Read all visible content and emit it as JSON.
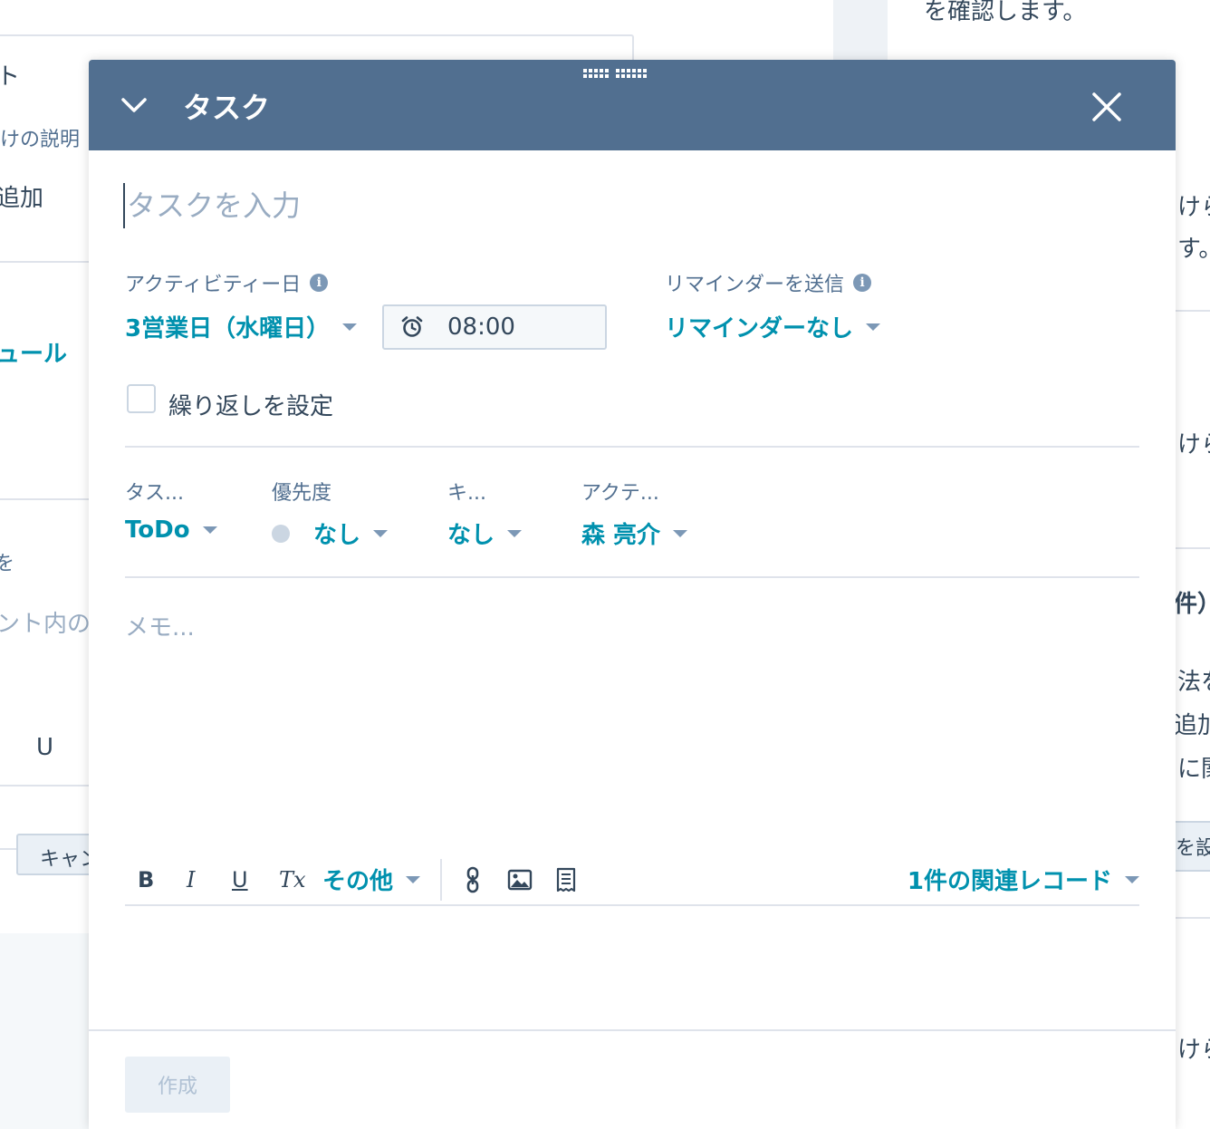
{
  "background": {
    "left_fragments": {
      "text_1": "ト",
      "text_2": "けの説明",
      "text_3": "追加",
      "link_1": "ュール",
      "text_4": "を",
      "text_5": "ント内の",
      "underline_glyph": "U",
      "cancel_button": "キャン"
    },
    "right_fragments": {
      "top_text": "を確認します。",
      "text_1": "けら",
      "text_2": "す。",
      "text_3": "けら",
      "text_4": "件）",
      "text_5": "法を",
      "text_6": "追加",
      "text_7": "に関",
      "button": "を設",
      "text_8": "けら"
    }
  },
  "modal": {
    "title": "タスク",
    "task_input": {
      "placeholder": "タスクを入力",
      "value": ""
    },
    "activity_date": {
      "label": "アクティビティー日",
      "value": "3営業日（水曜日）",
      "time": "08:00"
    },
    "reminder": {
      "label": "リマインダーを送信",
      "value": "リマインダーなし"
    },
    "repeat": {
      "label": "繰り返しを設定",
      "checked": false
    },
    "properties": [
      {
        "label": "タス...",
        "value": "ToDo"
      },
      {
        "label": "優先度",
        "value": "なし"
      },
      {
        "label": "キ...",
        "value": "なし"
      },
      {
        "label": "アクテ...",
        "value": "森 亮介"
      }
    ],
    "memo": {
      "placeholder": "メモ..."
    },
    "toolbar": {
      "bold": "B",
      "italic": "I",
      "underline": "U",
      "clear_format": "Tx",
      "more": "その他",
      "associations": "1件の関連レコード"
    },
    "create_button": "作成"
  }
}
